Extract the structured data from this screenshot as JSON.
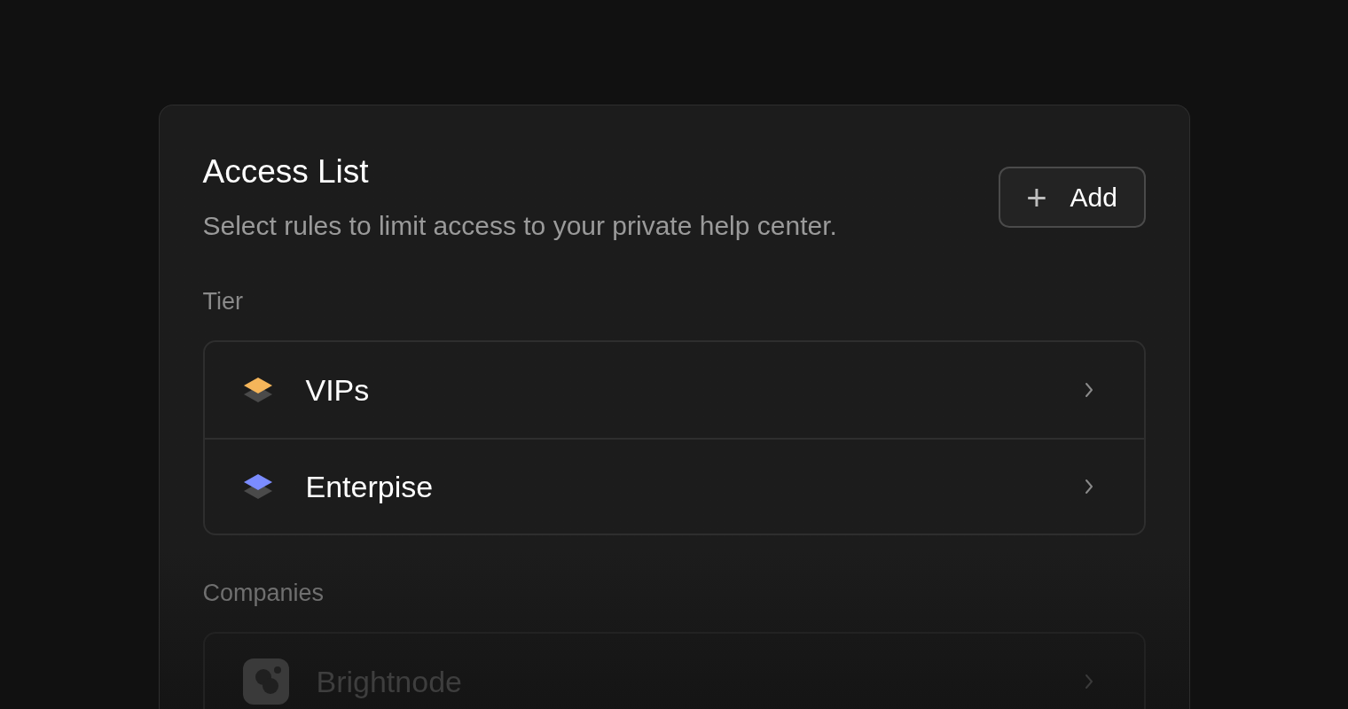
{
  "card": {
    "title": "Access List",
    "subtitle": "Select rules to limit access to your private help center.",
    "add_button": {
      "icon": "+",
      "label": "Add"
    }
  },
  "sections": [
    {
      "label": "Tier",
      "items": [
        {
          "kind": "tier",
          "name": "VIPs",
          "color": "#f5b55a"
        },
        {
          "kind": "tier",
          "name": "Enterpise",
          "color": "#7b8cff"
        }
      ]
    },
    {
      "label": "Companies",
      "items": [
        {
          "kind": "company",
          "name": "Brightnode"
        }
      ]
    }
  ]
}
